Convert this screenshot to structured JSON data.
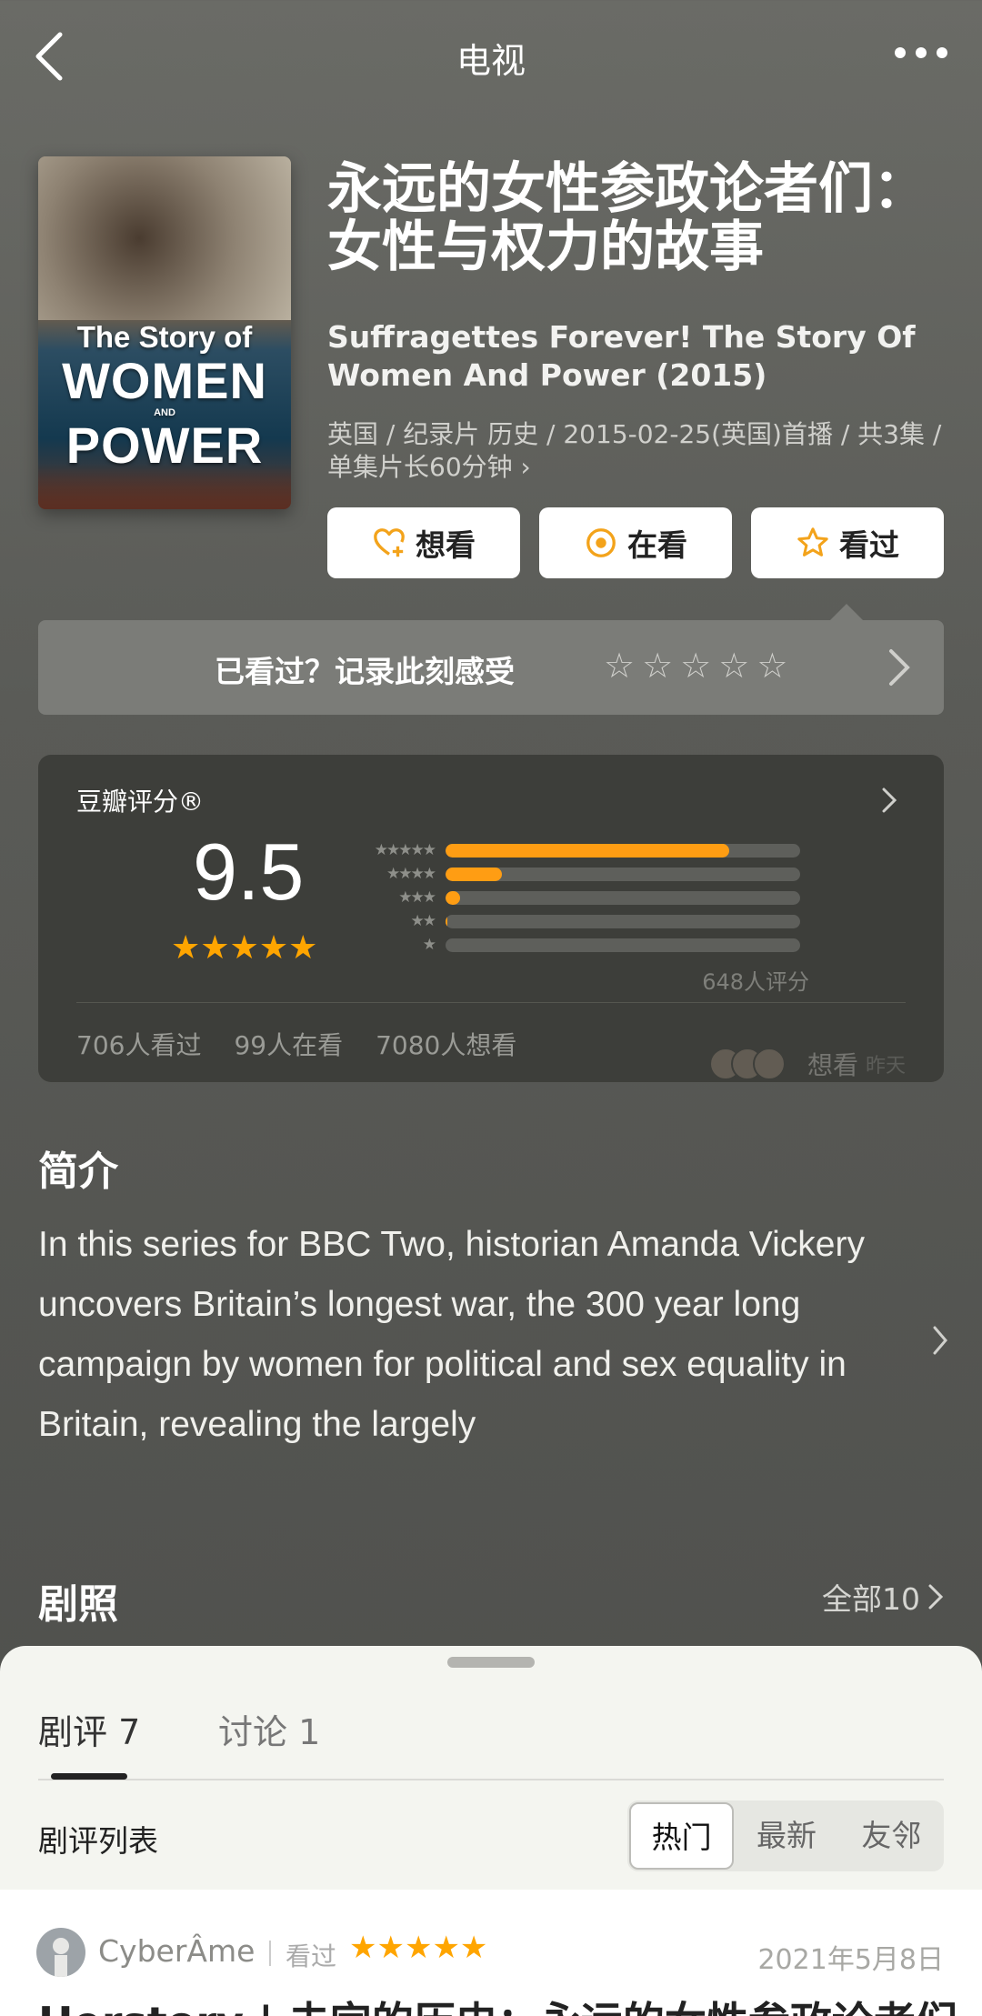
{
  "header": {
    "title": "电视"
  },
  "poster": {
    "line1": "The Story of",
    "line2": "WOMEN",
    "line3": "AND",
    "line4": "POWER"
  },
  "subject": {
    "title_cn": "永远的女性参政论者们：女性与权力的故事",
    "title_en": "Suffragettes Forever! The Story Of Women And Power (2015)",
    "meta": "英国 / 纪录片 历史 / 2015-02-25(英国)首播 / 共3集 / 单集片长60分钟 ›"
  },
  "actions": {
    "want": "想看",
    "watching": "在看",
    "watched": "看过"
  },
  "record": {
    "prompt": "已看过？记录此刻感受",
    "stars": [
      "☆",
      "☆",
      "☆",
      "☆",
      "☆"
    ]
  },
  "rating": {
    "label": "豆瓣评分®",
    "score": "9.5",
    "stars": "★★★★★",
    "distribution": [
      {
        "stars": "★★★★★",
        "fraction": 0.8
      },
      {
        "stars": "★★★★",
        "fraction": 0.16
      },
      {
        "stars": "★★★",
        "fraction": 0.04
      },
      {
        "stars": "★★",
        "fraction": 0.005
      },
      {
        "stars": "★",
        "fraction": 0.0
      }
    ],
    "count": "648人评分",
    "stats": [
      "706人看过",
      "99人在看",
      "7080人想看"
    ],
    "friend_action": "想看",
    "friend_time": "昨天"
  },
  "intro": {
    "title": "简介",
    "text": "In this series for BBC Two, historian Amanda Vickery uncovers Britain’s longest war, the 300 year long campaign by women for political and sex equality in Britain, revealing the largely"
  },
  "stills": {
    "title": "剧照",
    "all": "全部10"
  },
  "sheet": {
    "tab_reviews": "剧评 7",
    "tab_discuss": "讨论 1",
    "list_label": "剧评列表",
    "sort": [
      "热门",
      "最新",
      "友邻"
    ]
  },
  "review": {
    "user": "CyberÂme",
    "status": "看过",
    "stars": "★★★★★",
    "date": "2021年5月8日",
    "title": "Herstory | 未完的历史：永远的女性参政论者们"
  }
}
